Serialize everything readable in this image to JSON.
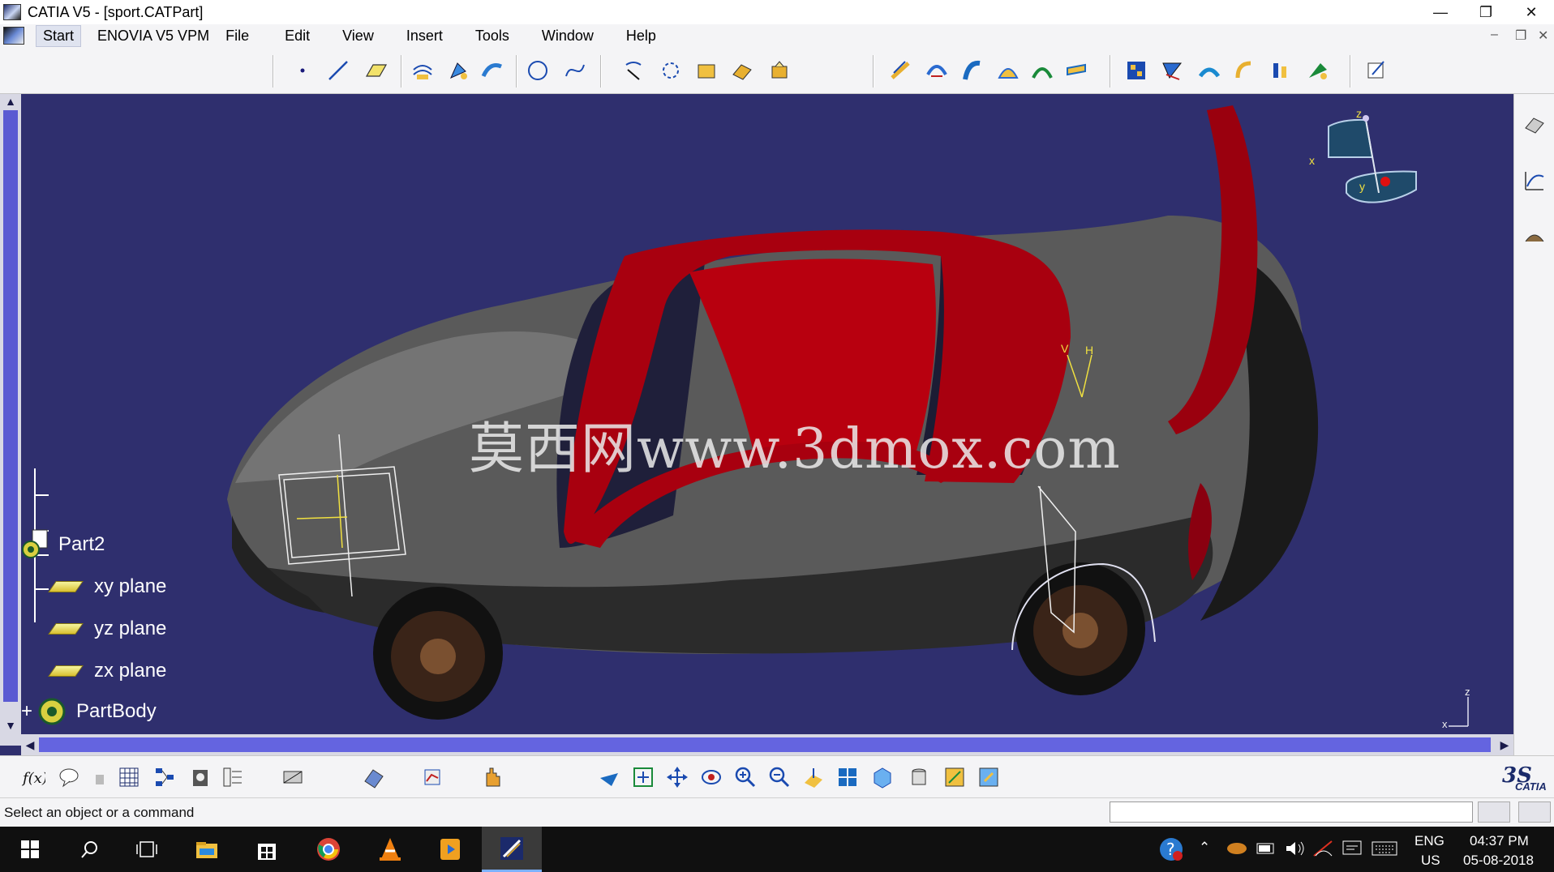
{
  "window": {
    "title": "CATIA V5 - [sport.CATPart]"
  },
  "menu": {
    "items": [
      "Start",
      "ENOVIA V5 VPM",
      "File",
      "Edit",
      "View",
      "Insert",
      "Tools",
      "Window",
      "Help"
    ]
  },
  "tree": {
    "root": "Part2",
    "children": [
      "xy plane",
      "yz plane",
      "zx plane",
      "PartBody"
    ]
  },
  "compass": {
    "labels": [
      "z",
      "x",
      "y"
    ]
  },
  "axis_triad": {
    "labels": [
      "z",
      "x"
    ]
  },
  "annotations": {
    "axis_marker_labels": [
      "V",
      "H"
    ]
  },
  "watermark": "莫西网www.3dmox.com",
  "status": {
    "message": "Select an object or a command",
    "command_input": ""
  },
  "branding": {
    "logo_text": "CATIA"
  },
  "taskbar": {
    "language": "ENG",
    "region": "US",
    "time": "04:37 PM",
    "date": "05-08-2018"
  },
  "colors": {
    "viewport_bg": "#2f2f6e",
    "car_body": "#5a5a5a",
    "roof": "#b0000e",
    "scrollbar": "#6464e0"
  },
  "icons": {
    "top_toolbar": [
      "point-icon",
      "line-icon",
      "plane-icon",
      "extrude-icon",
      "revolve-icon",
      "sweep-icon",
      "circle-icon",
      "spline-icon",
      "project-icon",
      "intersect-icon",
      "boundary-icon",
      "join-icon",
      "healing-icon",
      "fillet-icon",
      "offset-icon",
      "blend-icon",
      "fill-icon",
      "loft-icon",
      "surface-icon",
      "split-icon",
      "trim-icon",
      "extract-icon",
      "translate-icon",
      "rotate-icon",
      "symmetry-icon",
      "scale-icon",
      "sketch-icon"
    ],
    "bottom_toolbar": [
      "formula-icon",
      "comment-icon",
      "lock-icon",
      "table-icon",
      "graph-icon",
      "catalog-icon",
      "tree-icon",
      "measure-icon",
      "apply-material-icon",
      "analysis-icon",
      "hand-icon",
      "fly-icon",
      "fit-all-icon",
      "pan-icon",
      "rotate-view-icon",
      "zoom-in-icon",
      "zoom-out-icon",
      "normal-view-icon",
      "multi-view-icon",
      "iso-view-icon",
      "shading-icon",
      "hide-show-icon",
      "swap-icon"
    ]
  }
}
